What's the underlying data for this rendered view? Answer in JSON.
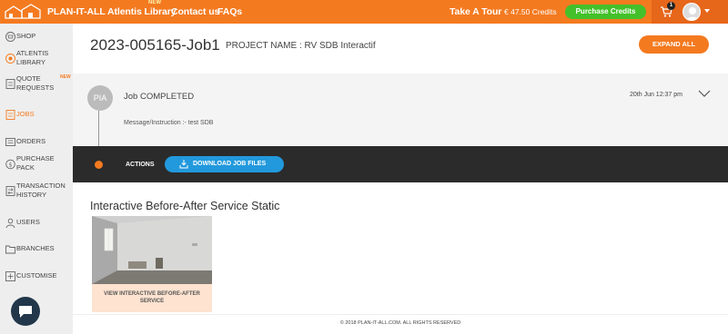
{
  "header": {
    "logo_icon": "house-logo-icon",
    "brand": "PLAN-IT-ALL",
    "nav": [
      "Atlentis Library",
      "Contact us",
      "FAQs"
    ],
    "new_badge": "NEW",
    "tour": "Take A Tour",
    "credits": "€ 47.50 Credits",
    "purchase_credits": "Purchase Credits",
    "cart_count": "1",
    "brand_color": "#f47a20",
    "purchase_color": "#44c02a"
  },
  "sidebar": {
    "items": [
      {
        "label": "SHOP",
        "icon": "shop-icon"
      },
      {
        "label": "ATLENTIS LIBRARY",
        "icon": "library-icon",
        "badge": "NEW"
      },
      {
        "label": "QUOTE REQUESTS",
        "icon": "quote-icon"
      },
      {
        "label": "JOBS",
        "icon": "jobs-icon",
        "active": true
      },
      {
        "label": "ORDERS",
        "icon": "orders-icon"
      },
      {
        "label": "PURCHASE PACK",
        "icon": "purchase-pack-icon"
      },
      {
        "label": "TRANSACTION HISTORY",
        "icon": "transaction-icon"
      },
      {
        "label": "USERS",
        "icon": "users-icon"
      },
      {
        "label": "BRANCHES",
        "icon": "branches-icon"
      },
      {
        "label": "CUSTOMISE",
        "icon": "customise-icon"
      }
    ]
  },
  "main": {
    "job_id": "2023-005165-Job1",
    "project_name": "PROJECT NAME : RV SDB Interactif",
    "expand_all": "EXPAND ALL",
    "entry": {
      "avatar_initials": "PIA",
      "status": "Job COMPLETED",
      "date": "20th Jun 12:37 pm",
      "message": "Message/Instruction :- test SDB"
    },
    "actions_label": "ACTIONS",
    "download_button": "DOWNLOAD JOB FILES",
    "service_title": "Interactive Before-After Service Static",
    "card_link": "VIEW INTERACTIVE BEFORE-AFTER SERVICE"
  },
  "footer": "© 2018 PLAN-IT-ALL.COM. ALL RIGHTS RESERVED"
}
